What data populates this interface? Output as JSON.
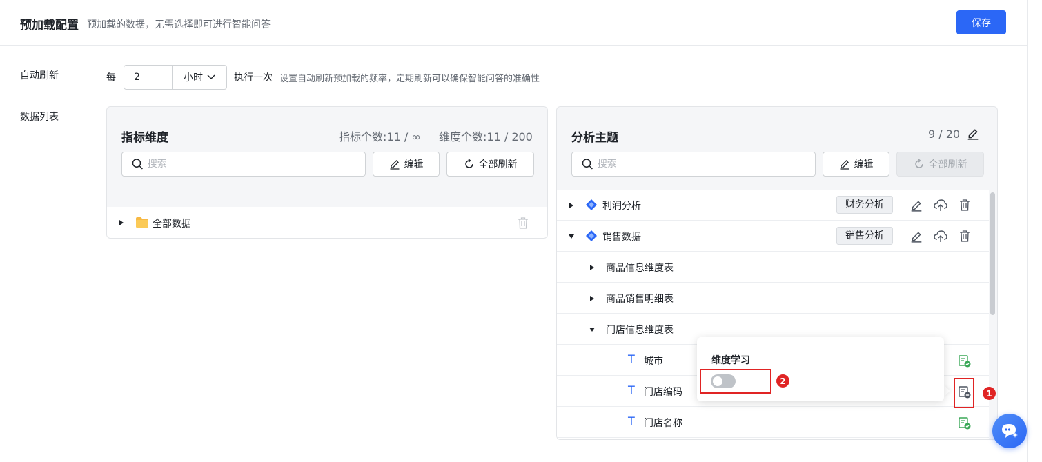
{
  "header": {
    "title": "预加载配置",
    "subtitle": "预加载的数据，无需选择即可进行智能问答",
    "save_label": "保存"
  },
  "auto_refresh": {
    "label": "自动刷新",
    "every": "每",
    "interval_value": "2",
    "unit": "小时",
    "exec_label": "执行一次",
    "hint": "设置自动刷新预加载的频率，定期刷新可以确保智能问答的准确性"
  },
  "data_list": {
    "label": "数据列表",
    "left_panel": {
      "title": "指标维度",
      "metric_count": "指标个数:11 / ∞",
      "dimension_count": "维度个数:11 / 200",
      "search_placeholder": "搜索",
      "edit_label": "编辑",
      "refresh_label": "全部刷新",
      "root_item": "全部数据"
    },
    "right_panel": {
      "title": "分析主题",
      "count": "9 / 20",
      "search_placeholder": "搜索",
      "edit_label": "编辑",
      "refresh_label": "全部刷新",
      "topics": [
        {
          "name": "利润分析",
          "tag": "财务分析"
        },
        {
          "name": "销售数据",
          "tag": "销售分析"
        }
      ],
      "tables": [
        "商品信息维度表",
        "商品销售明细表",
        "门店信息维度表"
      ],
      "fields": [
        "城市",
        "门店编码",
        "门店名称"
      ]
    }
  },
  "popover": {
    "title": "维度学习",
    "toggle_on": false
  },
  "annotations": [
    "1",
    "2"
  ],
  "colors": {
    "primary": "#2b67f6",
    "annotation": "#e02424",
    "learned": "#3aa757"
  }
}
